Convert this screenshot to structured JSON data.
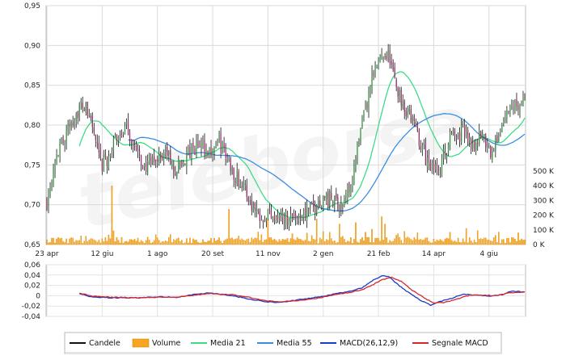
{
  "watermark": "teleborsa",
  "chart_data": [
    {
      "type": "candlestick",
      "panel": "price",
      "x_labels": [
        "23 apr",
        "12 giu",
        "1 ago",
        "20 set",
        "11 nov",
        "2 gen",
        "21 feb",
        "14 apr",
        "4 giu"
      ],
      "x_label_positions": [
        0,
        34,
        68,
        102,
        136,
        170,
        204,
        238,
        272
      ],
      "n_sessions": 295,
      "ylim": [
        0.65,
        0.95
      ],
      "yticks": [
        "0,95",
        "0,90",
        "0,85",
        "0,80",
        "0,75",
        "0,70",
        "0,65"
      ],
      "grid": true,
      "price_anchors": [
        [
          0,
          0.705
        ],
        [
          5,
          0.76
        ],
        [
          12,
          0.79
        ],
        [
          17,
          0.812
        ],
        [
          22,
          0.826
        ],
        [
          27,
          0.808
        ],
        [
          33,
          0.748
        ],
        [
          38,
          0.76
        ],
        [
          44,
          0.79
        ],
        [
          50,
          0.795
        ],
        [
          56,
          0.76
        ],
        [
          62,
          0.745
        ],
        [
          68,
          0.76
        ],
        [
          74,
          0.765
        ],
        [
          78,
          0.74
        ],
        [
          86,
          0.76
        ],
        [
          94,
          0.775
        ],
        [
          100,
          0.765
        ],
        [
          106,
          0.78
        ],
        [
          114,
          0.745
        ],
        [
          120,
          0.725
        ],
        [
          126,
          0.702
        ],
        [
          132,
          0.688
        ],
        [
          138,
          0.69
        ],
        [
          146,
          0.684
        ],
        [
          152,
          0.686
        ],
        [
          158,
          0.69
        ],
        [
          164,
          0.695
        ],
        [
          170,
          0.71
        ],
        [
          176,
          0.705
        ],
        [
          182,
          0.7
        ],
        [
          188,
          0.735
        ],
        [
          194,
          0.8
        ],
        [
          200,
          0.855
        ],
        [
          206,
          0.892
        ],
        [
          210,
          0.89
        ],
        [
          214,
          0.855
        ],
        [
          219,
          0.828
        ],
        [
          224,
          0.81
        ],
        [
          230,
          0.778
        ],
        [
          236,
          0.743
        ],
        [
          242,
          0.748
        ],
        [
          248,
          0.782
        ],
        [
          256,
          0.792
        ],
        [
          262,
          0.777
        ],
        [
          268,
          0.787
        ],
        [
          274,
          0.765
        ],
        [
          280,
          0.8
        ],
        [
          287,
          0.828
        ],
        [
          294,
          0.832
        ]
      ],
      "series": [
        {
          "name": "Candele",
          "color": "#111111"
        },
        {
          "name": "Media 21",
          "color": "#3ddc84"
        },
        {
          "name": "Media 55",
          "color": "#3b8fe0"
        }
      ],
      "candle_colors": {
        "up": "#2e8b3a",
        "down": "#9c2a6a",
        "wick": "#111111"
      }
    },
    {
      "type": "bar",
      "panel": "volume",
      "series_name": "Volume",
      "color": "#f5a623",
      "ylim": [
        0,
        500000
      ],
      "yticks": [
        "500 K",
        "400 K",
        "300 K",
        "200 K",
        "100 K",
        "0 K"
      ],
      "spikes": [
        [
          40,
          400000
        ],
        [
          112,
          240000
        ],
        [
          136,
          170000
        ],
        [
          166,
          175000
        ],
        [
          180,
          140000
        ],
        [
          190,
          150000
        ],
        [
          200,
          105000
        ],
        [
          206,
          190000
        ],
        [
          208,
          140000
        ],
        [
          220,
          90000
        ],
        [
          228,
          80000
        ],
        [
          258,
          110000
        ],
        [
          265,
          95000
        ],
        [
          278,
          85000
        ],
        [
          290,
          80000
        ]
      ]
    },
    {
      "type": "line",
      "panel": "macd",
      "ylim": [
        -0.04,
        0.06
      ],
      "yticks": [
        "0,06",
        "0,04",
        "0,02",
        "0",
        "-0,02",
        "-0,04"
      ],
      "grid": true,
      "series": [
        {
          "name": "MACD(26,12,9)",
          "color": "#1a3ac8",
          "anchors": [
            [
              20,
              0.005
            ],
            [
              28,
              -0.002
            ],
            [
              40,
              -0.003
            ],
            [
              56,
              -0.003
            ],
            [
              70,
              -0.001
            ],
            [
              80,
              -0.002
            ],
            [
              90,
              0.003
            ],
            [
              100,
              0.006
            ],
            [
              114,
              0.001
            ],
            [
              124,
              -0.005
            ],
            [
              134,
              -0.01
            ],
            [
              142,
              -0.012
            ],
            [
              152,
              -0.008
            ],
            [
              162,
              -0.004
            ],
            [
              170,
              0.0
            ],
            [
              178,
              0.005
            ],
            [
              186,
              0.009
            ],
            [
              194,
              0.016
            ],
            [
              200,
              0.029
            ],
            [
              206,
              0.039
            ],
            [
              210,
              0.038
            ],
            [
              216,
              0.022
            ],
            [
              222,
              0.008
            ],
            [
              230,
              -0.008
            ],
            [
              236,
              -0.017
            ],
            [
              240,
              -0.012
            ],
            [
              248,
              -0.005
            ],
            [
              256,
              0.004
            ],
            [
              264,
              0.002
            ],
            [
              272,
              0.0
            ],
            [
              280,
              0.003
            ],
            [
              286,
              0.01
            ],
            [
              294,
              0.008
            ]
          ]
        },
        {
          "name": "Segnale MACD",
          "color": "#d6262f",
          "anchors": [
            [
              20,
              0.006
            ],
            [
              28,
              0.0
            ],
            [
              40,
              -0.002
            ],
            [
              56,
              -0.003
            ],
            [
              70,
              -0.002
            ],
            [
              80,
              -0.002
            ],
            [
              90,
              0.002
            ],
            [
              100,
              0.005
            ],
            [
              114,
              0.003
            ],
            [
              124,
              -0.002
            ],
            [
              134,
              -0.008
            ],
            [
              142,
              -0.011
            ],
            [
              152,
              -0.009
            ],
            [
              162,
              -0.006
            ],
            [
              170,
              -0.002
            ],
            [
              178,
              0.003
            ],
            [
              186,
              0.007
            ],
            [
              194,
              0.012
            ],
            [
              200,
              0.021
            ],
            [
              206,
              0.031
            ],
            [
              212,
              0.036
            ],
            [
              218,
              0.028
            ],
            [
              224,
              0.013
            ],
            [
              232,
              -0.003
            ],
            [
              238,
              -0.013
            ],
            [
              244,
              -0.012
            ],
            [
              252,
              -0.006
            ],
            [
              260,
              0.002
            ],
            [
              268,
              0.002
            ],
            [
              276,
              0.001
            ],
            [
              284,
              0.006
            ],
            [
              294,
              0.008
            ]
          ]
        }
      ]
    }
  ],
  "legend": {
    "items": [
      {
        "label": "Candele",
        "kind": "line",
        "color": "#111111"
      },
      {
        "label": "Volume",
        "kind": "box",
        "color": "#f5a623"
      },
      {
        "label": "Media 21",
        "kind": "line",
        "color": "#3ddc84"
      },
      {
        "label": "Media 55",
        "kind": "line",
        "color": "#3b8fe0"
      },
      {
        "label": "MACD(26,12,9)",
        "kind": "line",
        "color": "#1a3ac8"
      },
      {
        "label": "Segnale MACD",
        "kind": "line",
        "color": "#d6262f"
      }
    ]
  }
}
